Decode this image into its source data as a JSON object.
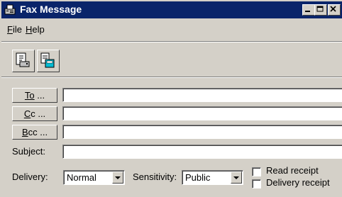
{
  "window": {
    "title": "Fax Message",
    "title_icon": "fax-icon",
    "controls": [
      "minimize-icon",
      "maximize-icon",
      "close-icon"
    ]
  },
  "menu": {
    "file_accel": "F",
    "file_rest": "ile",
    "help_accel": "H",
    "help_rest": "elp"
  },
  "toolbar": {
    "buttons": [
      "send-fax-icon",
      "attach-file-icon"
    ]
  },
  "address": {
    "to_accel": "T",
    "to_mid": "o",
    "to_rest": " ...",
    "cc_accel": "C",
    "cc_rest": "c ...",
    "bcc_accel": "B",
    "bcc_rest": "cc ...",
    "to_value": "",
    "cc_value": "",
    "bcc_value": ""
  },
  "subject": {
    "label": "Subject:",
    "value": ""
  },
  "options": {
    "delivery_label": "Delivery:",
    "delivery_value": "Normal",
    "sensitivity_label": "Sensitivity:",
    "sensitivity_value": "Public",
    "read_receipt_label": "Read receipt",
    "delivery_receipt_label": "Delivery receipt"
  },
  "colors": {
    "titlebar": "#0a246a",
    "face": "#d4d0c8"
  }
}
